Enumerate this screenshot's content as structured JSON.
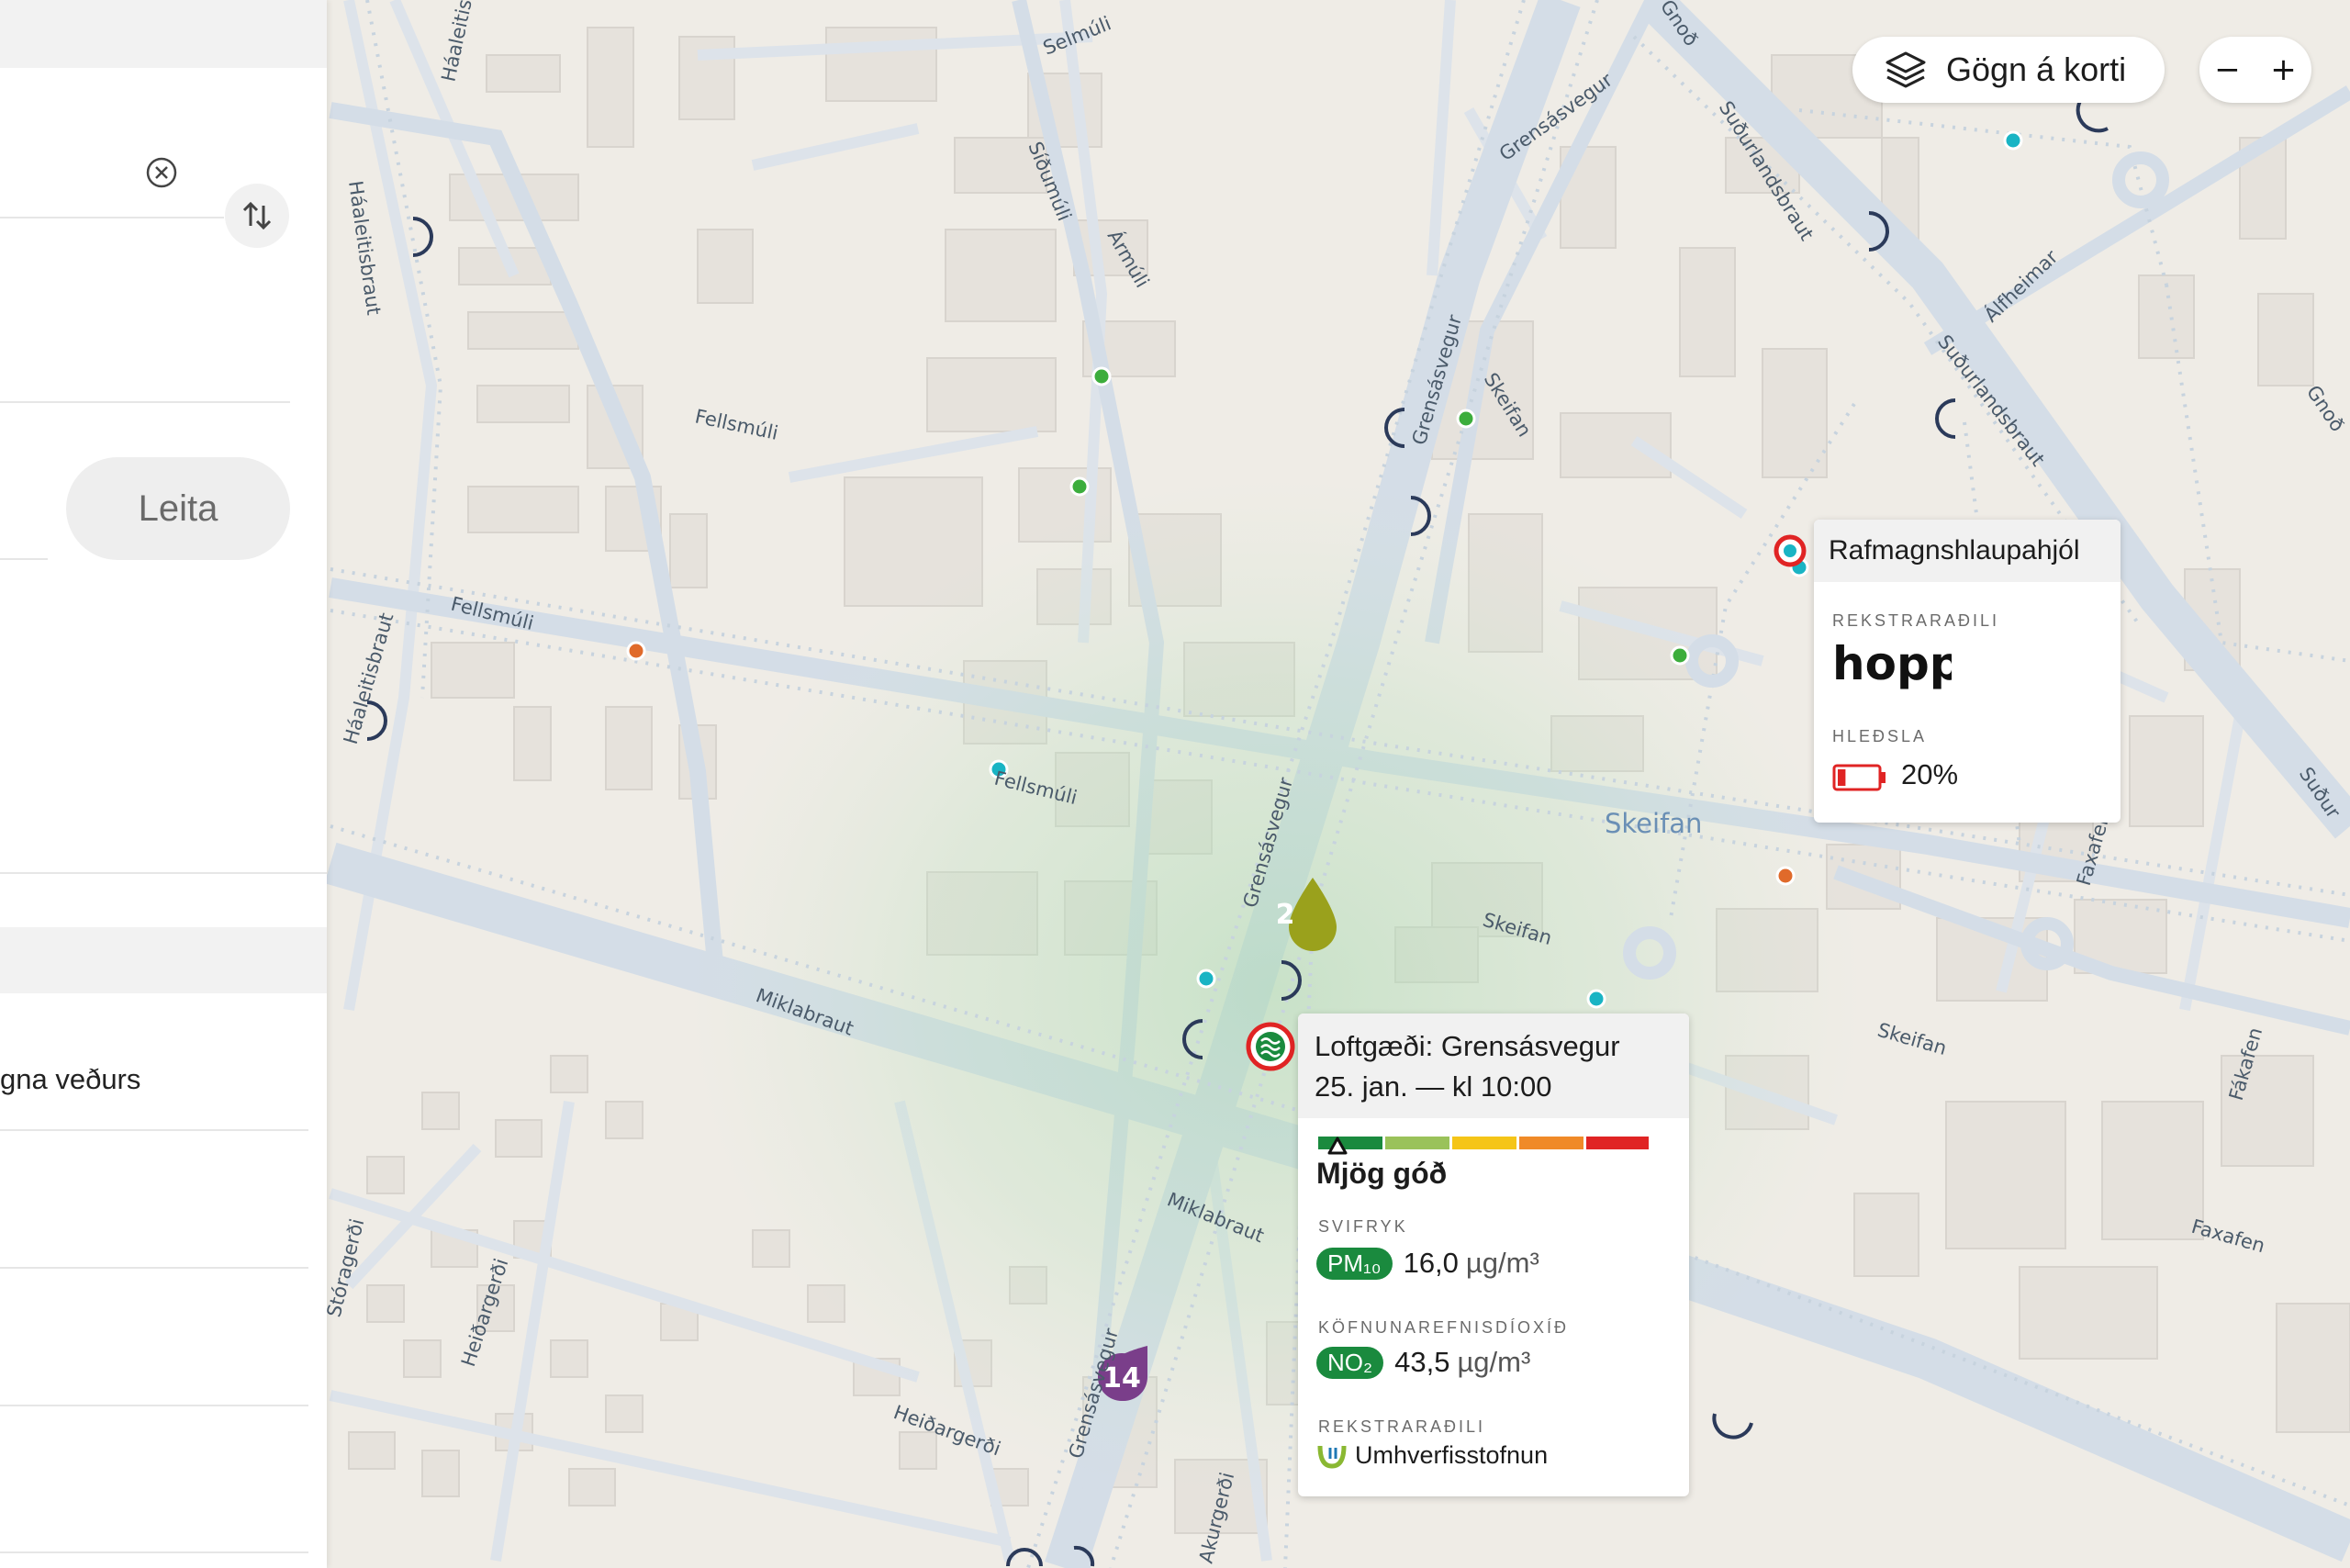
{
  "sidebar": {
    "search_button": "Leita",
    "weather_item": "gna veðurs"
  },
  "map": {
    "layers_button": "Gögn á korti",
    "zoom_out": "−",
    "zoom_in": "+",
    "district": "Skeifan",
    "streets": {
      "haaleitisbraut": "Háaleitisbraut",
      "selmuli": "Selmúli",
      "sidumuli": "Síðumúli",
      "armuli": "Ármúli",
      "grensasvegur": "Grensásvegur",
      "sudurlandsbraut": "Suðurlandsbraut",
      "alfheimar": "Álfheimar",
      "fellsmuli": "Fellsmúli",
      "skeifan": "Skeifan",
      "miklabraut": "Miklabraut",
      "faxafen": "Faxafen",
      "fakafen": "Fákafen",
      "heidargerdi": "Heiðargerði",
      "akurgerdi": "Akurgerði",
      "storagerdi": "Stóragerði",
      "gnodarvogur": "Gnoð",
      "sudur": "Suður"
    },
    "markers": {
      "cluster_green": "2",
      "cluster_purple": "14"
    }
  },
  "scooter_popup": {
    "title": "Rafmagnshlaupahjól",
    "operator_label": "REKSTRARAÐILI",
    "operator_logo": "hopp",
    "charge_label": "HLEÐSLA",
    "charge_value": "20%",
    "charge_fraction": 0.2
  },
  "air_quality_popup": {
    "title": "Loftgæði: Grensásvegur",
    "time": "25. jan. — kl 10:00",
    "scale_colors": [
      "#1a8a3e",
      "#9ac25a",
      "#f5c518",
      "#f08a28",
      "#e02424"
    ],
    "scale_level": 0,
    "quality": "Mjög góð",
    "pm_label": "SVIFRYK",
    "pm_badge": "PM₁₀",
    "pm_value": "16,0",
    "pm_unit": "µg/m³",
    "no2_label": "KÖFNUNAREFNISDÍOXÍÐ",
    "no2_badge": "NO₂",
    "no2_value": "43,5",
    "no2_unit": "µg/m³",
    "operator_label": "REKSTRARAÐILI",
    "operator": "Umhverfisstofnun"
  }
}
